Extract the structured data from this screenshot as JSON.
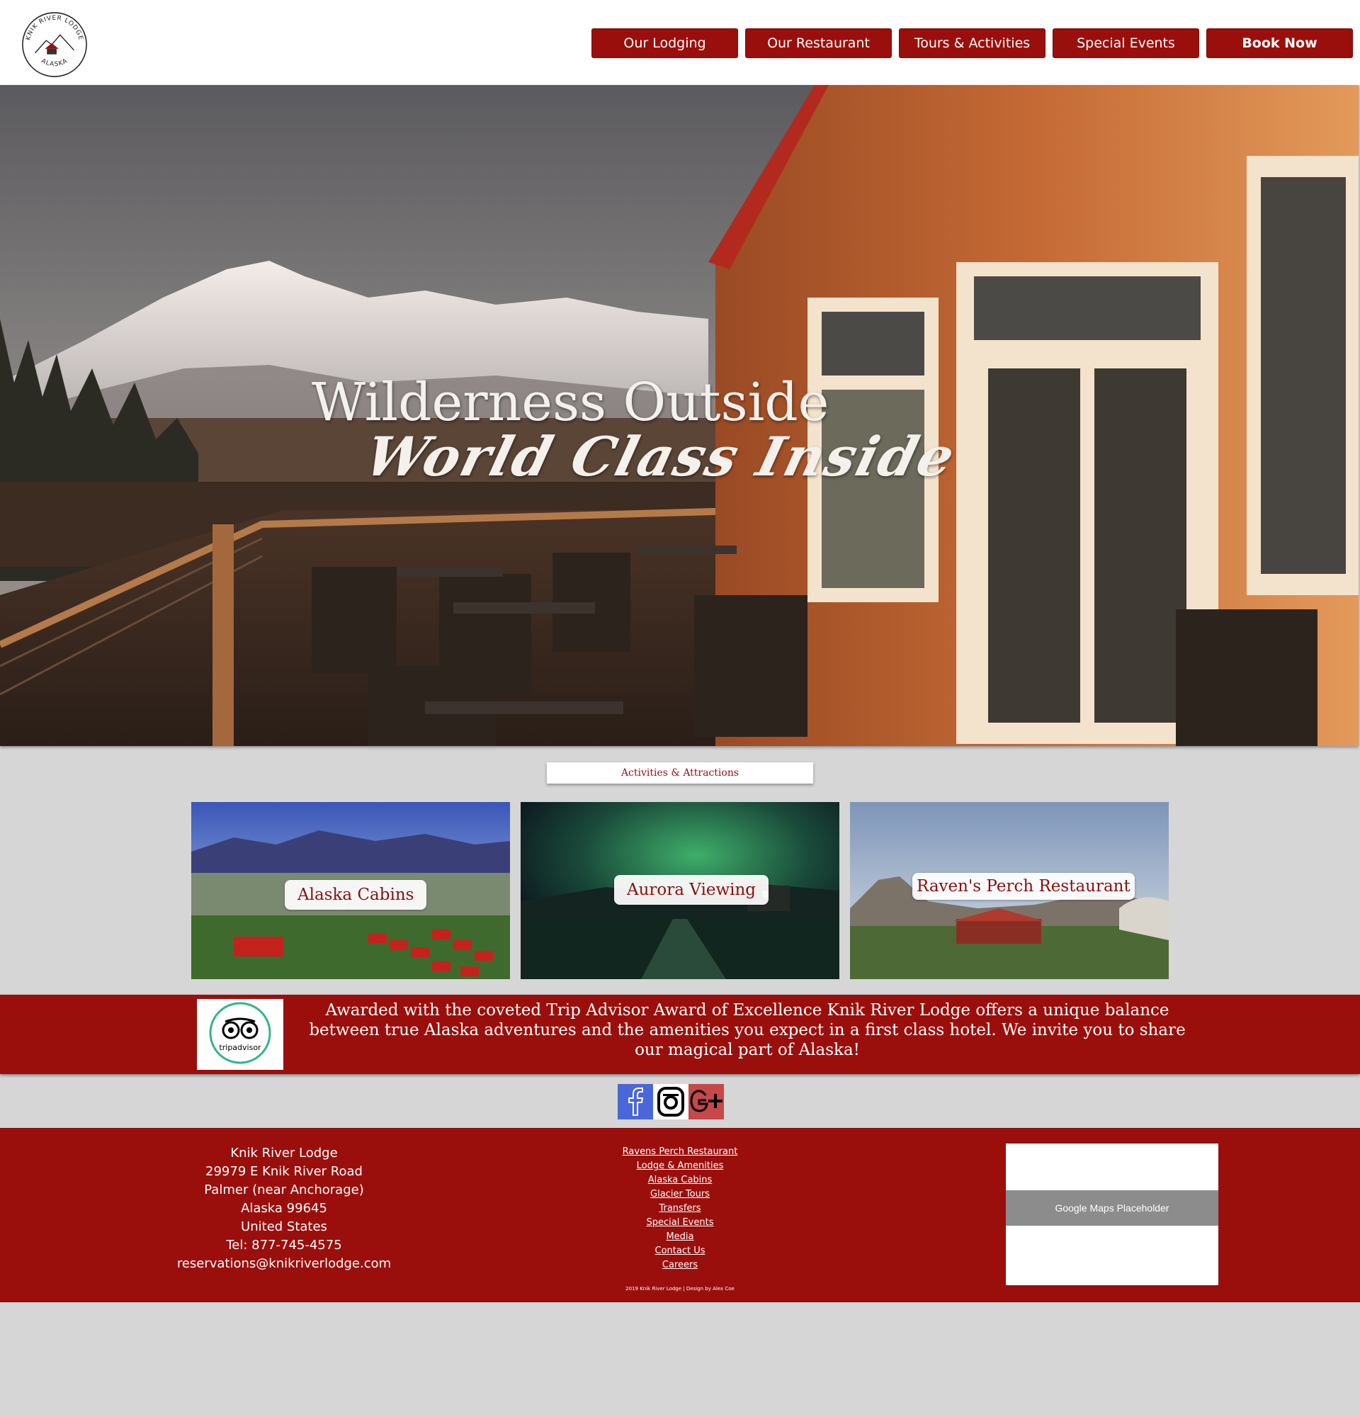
{
  "logo": {
    "top_text": "KNIK RIVER LODGE",
    "bottom_text": "ALASKA"
  },
  "nav": {
    "items": [
      {
        "label": "Our Lodging"
      },
      {
        "label": "Our Restaurant"
      },
      {
        "label": "Tours & Activities"
      },
      {
        "label": "Special Events"
      }
    ],
    "book_label": "Book Now"
  },
  "hero": {
    "title": "Wilderness Outside",
    "subtitle": "World Class Inside"
  },
  "activities": {
    "tag": "Activities & Attractions",
    "cards": [
      {
        "label": "Alaska Cabins"
      },
      {
        "label": "Aurora Viewing"
      },
      {
        "label": "Raven's Perch Restaurant"
      }
    ]
  },
  "award": {
    "badge_text": "tripadvisor",
    "text": "Awarded with the coveted Trip Advisor Award of Excellence Knik River Lodge offers a unique balance between true Alaska adventures and the amenities you expect in a first class hotel. We invite you to share our magical part of Alaska!"
  },
  "social": [
    {
      "icon": "facebook-icon",
      "color": "#4a66d8"
    },
    {
      "icon": "instagram-icon",
      "color": "#000000"
    },
    {
      "icon": "google-plus-icon",
      "color": "#c64848"
    }
  ],
  "footer": {
    "address": [
      "Knik River Lodge",
      "29979 E Knik River Road",
      "Palmer (near Anchorage)",
      "Alaska 99645",
      "United States",
      "Tel: 877-745-4575",
      "reservations@knikriverlodge.com"
    ],
    "links": [
      "Ravens Perch Restaurant",
      "Lodge & Amenities",
      "Alaska Cabins",
      "Glacier Tours",
      "Transfers",
      "Special Events",
      "Media",
      "Contact Us",
      "Careers"
    ],
    "copyright": "2019 Knik River Lodge | Design by Alex Coe",
    "map_placeholder": "Google Maps Placeholder"
  },
  "colors": {
    "brand_red": "#9a0f0c",
    "page_bg": "#d6d6d6"
  }
}
